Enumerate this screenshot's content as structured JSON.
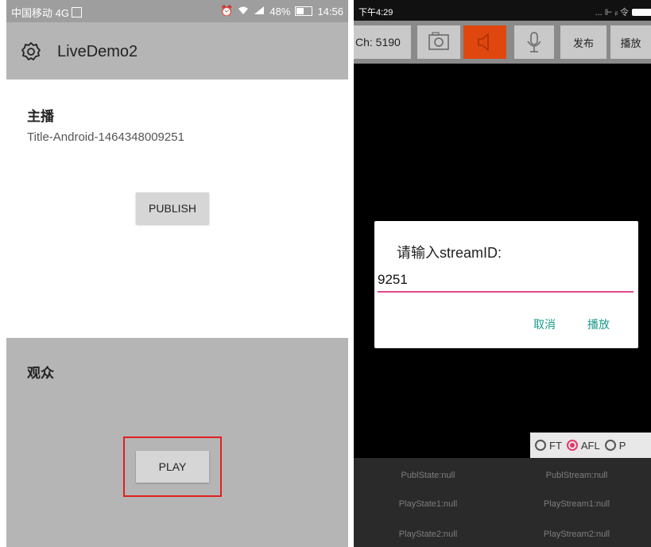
{
  "left": {
    "status": {
      "carrier": "中国移动 4G",
      "battery": "48%",
      "time": "14:56"
    },
    "appbar": {
      "title": "LiveDemo2",
      "icon": "gear-icon"
    },
    "broadcaster": {
      "heading": "主播",
      "stream_title": "Title-Android-1464348009251",
      "publish_label": "PUBLISH"
    },
    "audience": {
      "heading": "观众",
      "play_label": "PLAY"
    }
  },
  "right": {
    "status": {
      "time": "下午4:29",
      "indicators": "... ⊩ ᵢₗ 令"
    },
    "toolbar": {
      "channel": "Ch: 5190",
      "publish_label": "发布",
      "play_label": "播放",
      "mute_color": "#e0470e"
    },
    "dialog": {
      "title": "请输入streamID:",
      "value": "9251",
      "cancel_label": "取消",
      "ok_label": "播放",
      "accent": "#e04a8a"
    },
    "options": {
      "ft": "FT",
      "afl": "AFL",
      "p": "P"
    },
    "stats": {
      "publ_state": "PublState:null",
      "publ_stream": "PublStream:null",
      "play_state1": "PlayState1:null",
      "play_stream1": "PlayStream1:null",
      "play_state2": "PlayState2:null",
      "play_stream2": "PlayStream2:null"
    }
  }
}
